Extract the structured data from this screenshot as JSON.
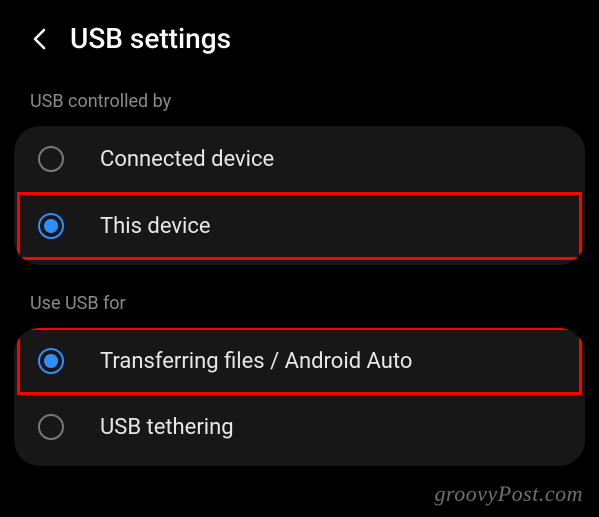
{
  "header": {
    "title": "USB settings"
  },
  "sections": {
    "controlled_by": {
      "label": "USB controlled by",
      "options": {
        "connected": "Connected device",
        "this_device": "This device"
      }
    },
    "use_for": {
      "label": "Use USB for",
      "options": {
        "transfer": "Transferring files / Android Auto",
        "tethering": "USB tethering"
      }
    }
  },
  "watermark": "groovyPost.com"
}
